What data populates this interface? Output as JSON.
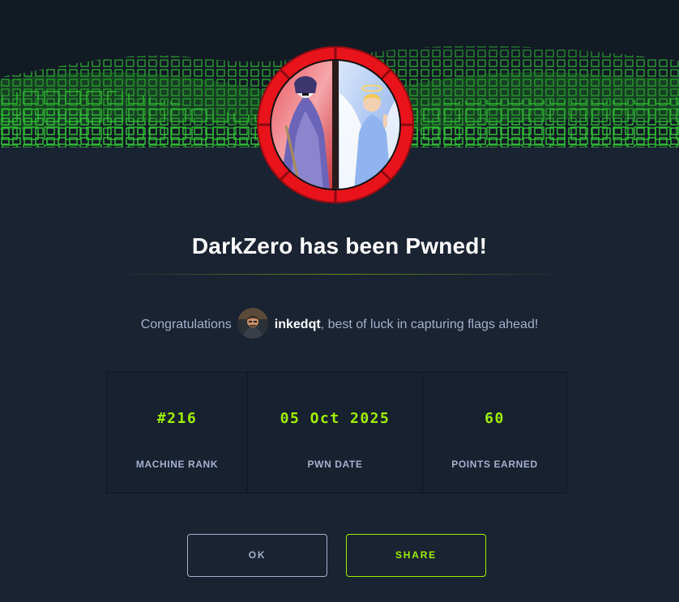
{
  "modal": {
    "title": "DarkZero has been Pwned!",
    "congrats": {
      "prefix": "Congratulations",
      "username": "inkedqt",
      "suffix": ", best of luck in capturing flags ahead!"
    },
    "stats": [
      {
        "value": "#216",
        "label": "MACHINE RANK"
      },
      {
        "value": "05 Oct 2025",
        "label": "PWN DATE"
      },
      {
        "value": "60",
        "label": "POINTS EARNED"
      }
    ],
    "buttons": {
      "ok_label": "OK",
      "share_label": "SHARE"
    }
  },
  "colors": {
    "background": "#1a2332",
    "accent_green": "#9fef00",
    "muted_text": "#a4b1cd",
    "badge_ring": "#e8131b"
  },
  "icons": {
    "banner": "green-cube-wave-banner",
    "machine_badge": "machine-avatar-icon",
    "user_avatar": "user-avatar"
  }
}
